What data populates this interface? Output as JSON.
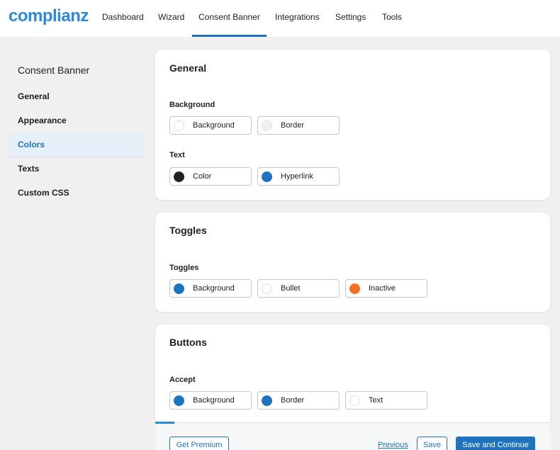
{
  "logo": "complianz",
  "nav": {
    "items": [
      "Dashboard",
      "Wizard",
      "Consent Banner",
      "Integrations",
      "Settings",
      "Tools"
    ],
    "active": "Consent Banner"
  },
  "sidebar": {
    "title": "Consent Banner",
    "items": [
      "General",
      "Appearance",
      "Colors",
      "Texts",
      "Custom CSS"
    ],
    "active": "Colors"
  },
  "cards": {
    "general": {
      "title": "General",
      "background_label": "Background",
      "background_options": [
        {
          "label": "Background",
          "color": "#ffffff"
        },
        {
          "label": "Border",
          "color": "#f0f0f0"
        }
      ],
      "text_label": "Text",
      "text_options": [
        {
          "label": "Color",
          "color": "#222222"
        },
        {
          "label": "Hyperlink",
          "color": "#1e73be"
        }
      ]
    },
    "toggles": {
      "title": "Toggles",
      "group_label": "Toggles",
      "options": [
        {
          "label": "Background",
          "color": "#1e73be"
        },
        {
          "label": "Bullet",
          "color": "#ffffff"
        },
        {
          "label": "Inactive",
          "color": "#f37021"
        }
      ]
    },
    "buttons": {
      "title": "Buttons",
      "group_label": "Accept",
      "options": [
        {
          "label": "Background",
          "color": "#1e73be"
        },
        {
          "label": "Border",
          "color": "#1e73be"
        },
        {
          "label": "Text",
          "color": "#ffffff"
        }
      ]
    }
  },
  "footer": {
    "get_premium": "Get Premium",
    "previous": "Previous",
    "save": "Save",
    "save_continue": "Save and Continue"
  }
}
